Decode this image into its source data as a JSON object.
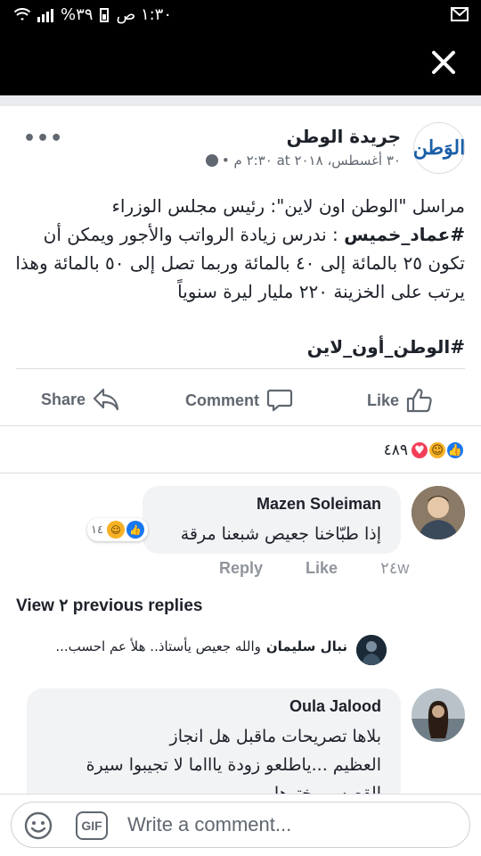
{
  "status_bar": {
    "time": "١:٣٠ ص",
    "battery": "%٣٩"
  },
  "post": {
    "page_name": "جريدة الوطن",
    "logo_text": "الوَطن",
    "timestamp": "٣٠ أغسطس، ٢٠١٨ at ٢:٣٠ م •",
    "body_line1": "مراسل \"الوطن اون لاين\": رئيس مجلس الوزراء",
    "body_hashtag": "#عماد_خميس",
    "body_line2_rest": ": ندرس زيادة الرواتب والأجور ويمكن أن",
    "body_line3": "تكون ٢٥ بالمائة إلى ٤٠ بالمائة وربما تصل إلى ٥٠ بالمائة وهذا",
    "body_line4": "يرتب على الخزينة ٢٢٠ مليار ليرة سنوياً",
    "hashtag": "#الوطن_أون_لاين",
    "actions": {
      "share": "Share",
      "comment": "Comment",
      "like": "Like"
    }
  },
  "reactions": {
    "count": "٤٨٩"
  },
  "comments": [
    {
      "name": "Mazen Soleiman",
      "text": "إذا طبّاخنا جعيص شبعنا مرقة",
      "age": "٢٤w",
      "like_label": "Like",
      "reply_label": "Reply",
      "reaction_count": "١٤"
    },
    {
      "name": "Oula Jalood",
      "text_line1": "بلاها تصريحات ماقبل هل انجاز",
      "text_line2": "العظيم ...ياطلعو زودة ياااما لا تجيبوا سيرة",
      "text_line3": "القصه...بيختوها"
    }
  ],
  "view_replies": "View ٢ previous replies",
  "reply": {
    "name": "نبال سليمان",
    "text": "والله جعيص يأستاذ.. هلأ عم احسب..."
  },
  "composer": {
    "placeholder": "Write a comment...",
    "gif_label": "GIF"
  },
  "colors": {
    "brand_blue": "#1877f2",
    "haha_yellow": "#f7b125",
    "love_red": "#f33e58"
  }
}
